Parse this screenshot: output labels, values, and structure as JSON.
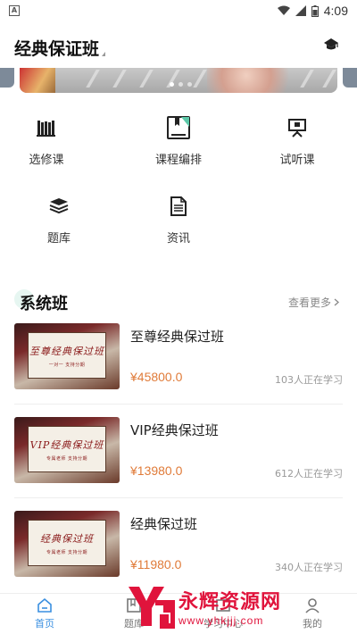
{
  "status_bar": {
    "time": "4:09"
  },
  "header": {
    "title": "经典保证班"
  },
  "banner": {
    "dots": 3,
    "active_dot": 0
  },
  "grid": [
    {
      "label": "选修课",
      "icon": "books-icon"
    },
    {
      "label": "课程编排",
      "icon": "bookmark-book-icon"
    },
    {
      "label": "试听课",
      "icon": "presentation-board-icon"
    },
    {
      "label": "题库",
      "icon": "stack-icon"
    },
    {
      "label": "资讯",
      "icon": "document-icon"
    }
  ],
  "section": {
    "title": "系统班",
    "more": "查看更多"
  },
  "courses": [
    {
      "name": "至尊经典保过班",
      "price": "¥45800.0",
      "learners": "103人正在学习",
      "thumb_title": "至尊经典保过班",
      "thumb_sub": "一对一 支持分期"
    },
    {
      "name": "VIP经典保过班",
      "price": "¥13980.0",
      "learners": "612人正在学习",
      "thumb_title": "VIP经典保过班",
      "thumb_sub": "专属老师 支持分期"
    },
    {
      "name": "经典保过班",
      "price": "¥11980.0",
      "learners": "340人正在学习",
      "thumb_title": "经典保过班",
      "thumb_sub": "专属老师 支持分期"
    }
  ],
  "tabs": [
    {
      "label": "首页",
      "active": true
    },
    {
      "label": "题库",
      "active": false
    },
    {
      "label": "学习中心",
      "active": false
    },
    {
      "label": "我的",
      "active": false
    }
  ],
  "watermark": {
    "title": "永辉资源网",
    "url": "www.yhkjjj.com"
  },
  "colors": {
    "accent": "#3a8fe0",
    "price": "#e07b39",
    "watermark": "#e0143c"
  }
}
